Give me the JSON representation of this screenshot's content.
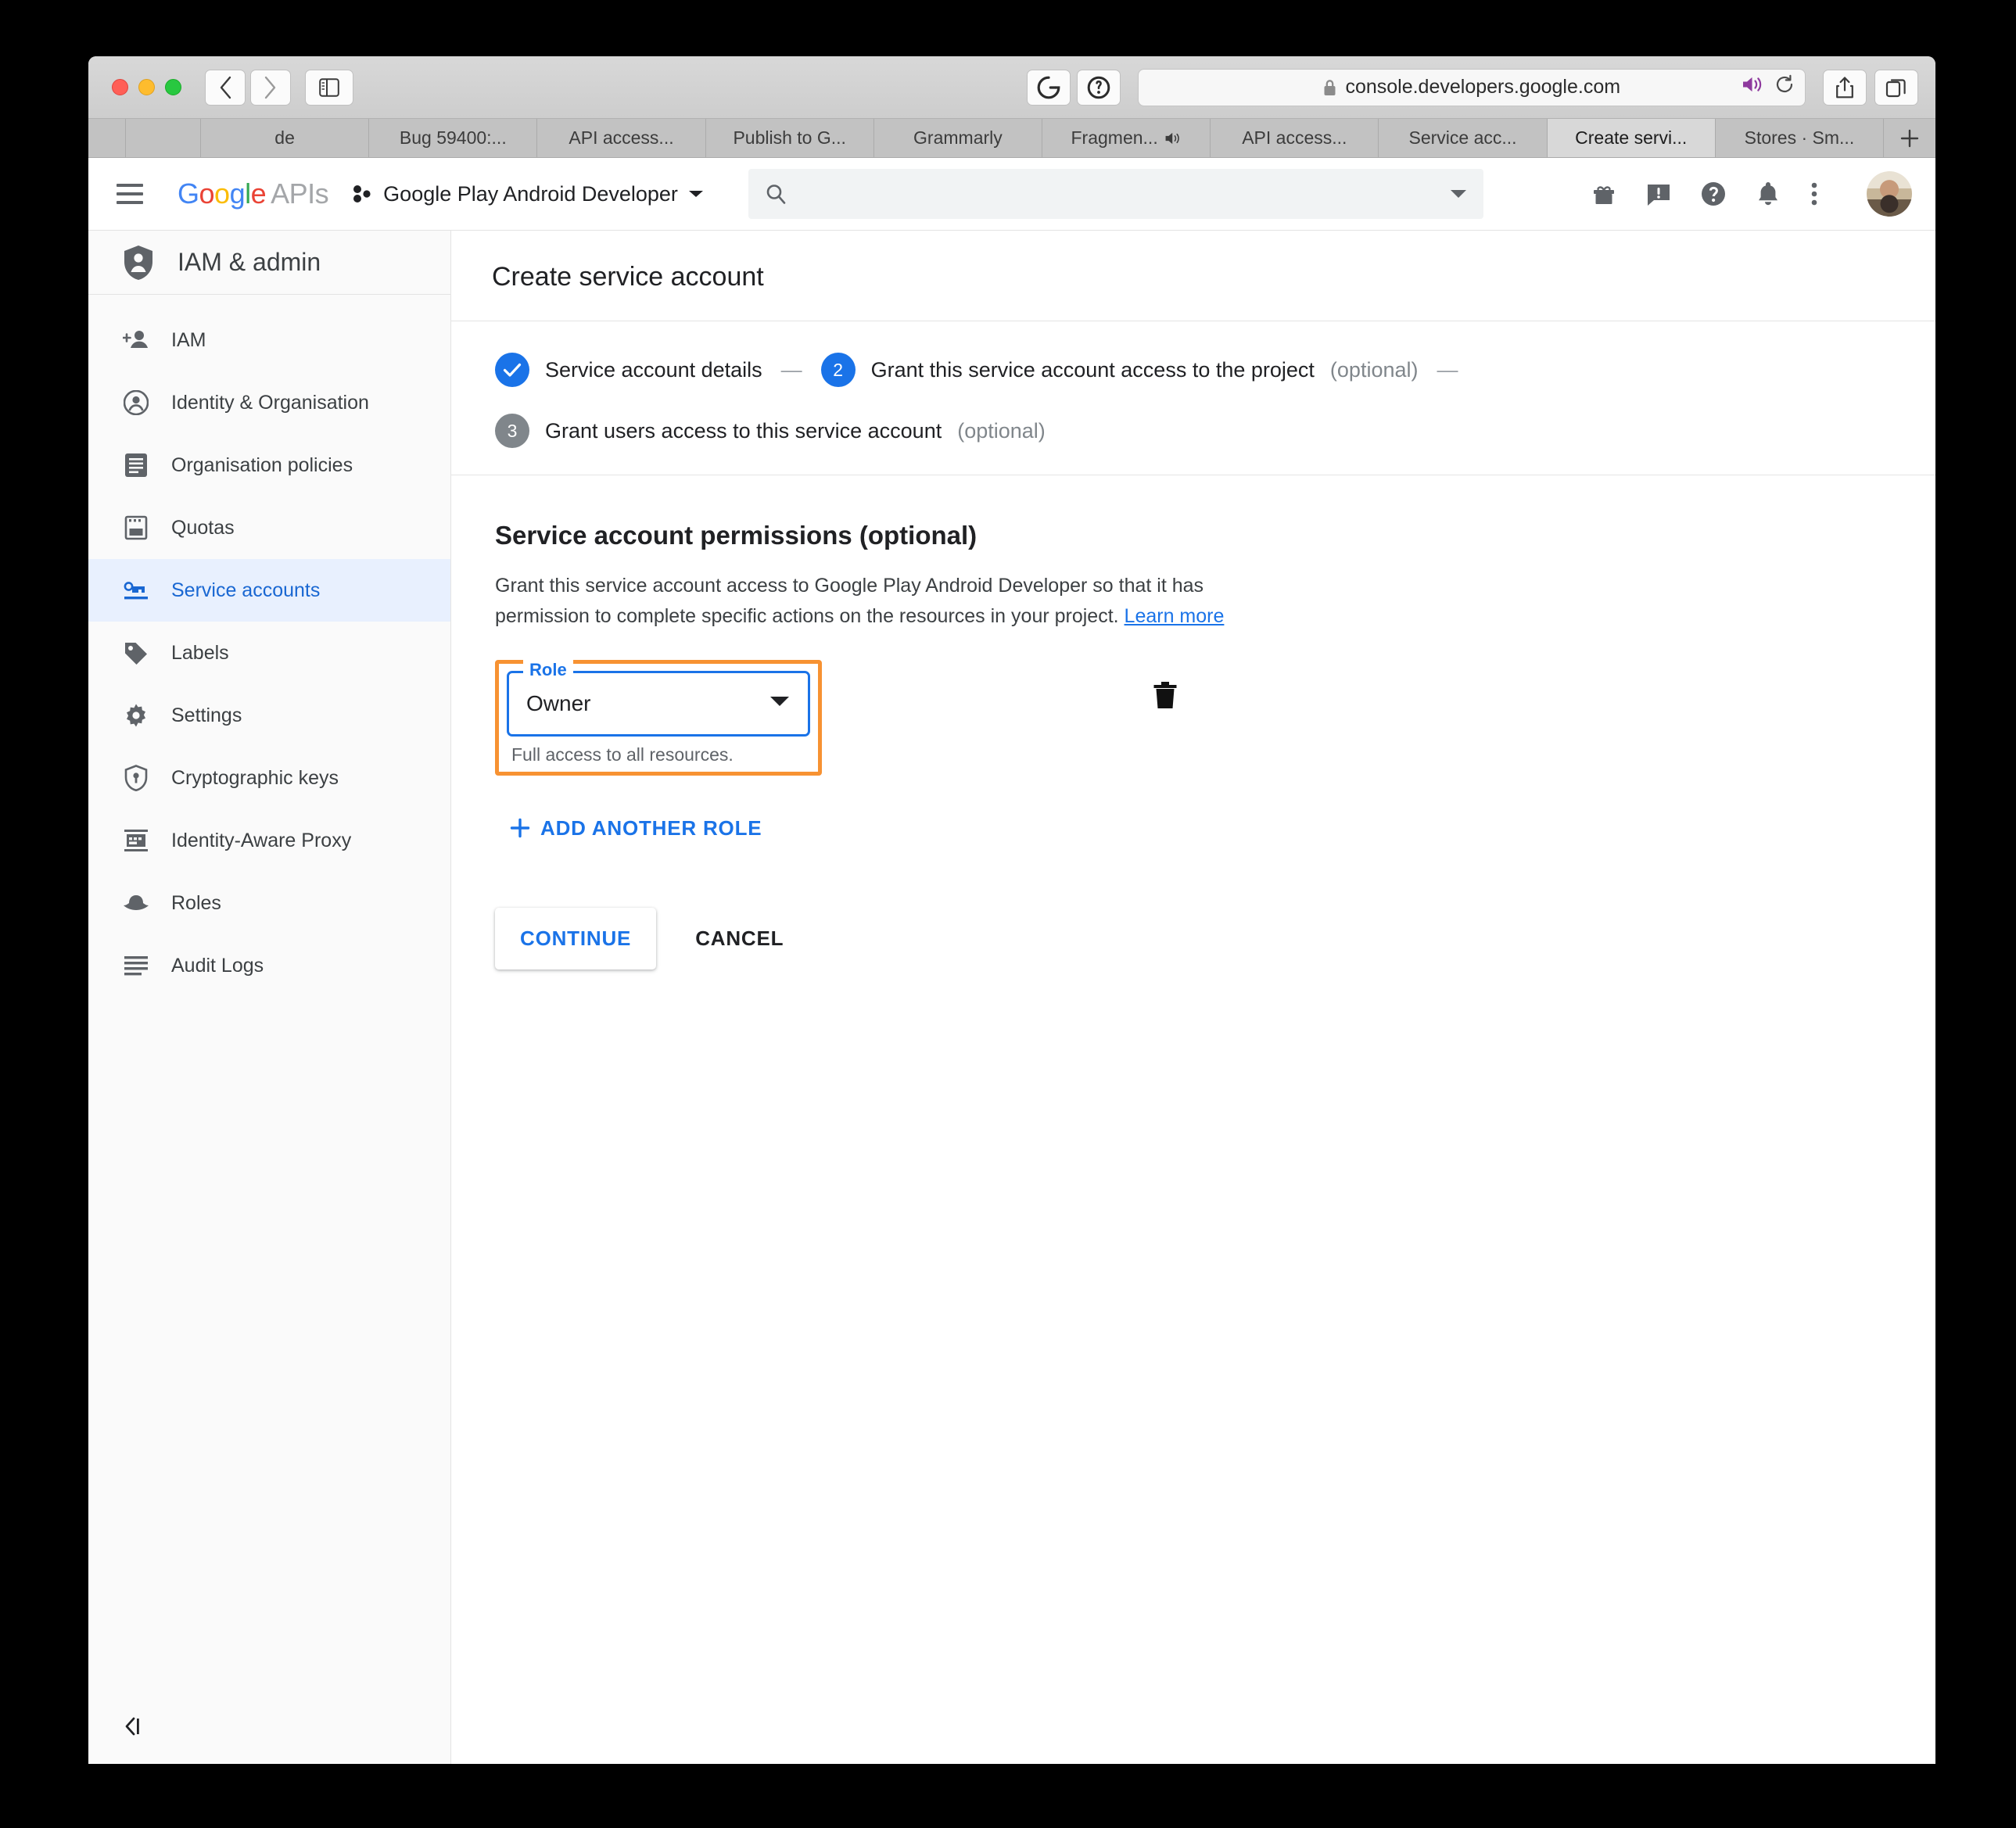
{
  "browser": {
    "url": "console.developers.google.com",
    "lock_icon": "lock-icon",
    "back_icon": "chevron-left-icon",
    "forward_icon": "chevron-right-icon",
    "sidebar_icon": "sidebar-toggle-icon",
    "grammarly_icon": "grammarly-extension-icon",
    "onepassword_icon": "1password-extension-icon",
    "audio_icon": "speaker-playing-icon",
    "reload_icon": "reload-icon",
    "share_icon": "share-icon",
    "tabs_overview_icon": "tab-overview-icon",
    "new_tab_icon": "plus-icon",
    "tabs": [
      {
        "label": "",
        "muted": false
      },
      {
        "label": "",
        "muted": false
      },
      {
        "label": "de",
        "muted": false
      },
      {
        "label": "Bug 59400:...",
        "muted": false
      },
      {
        "label": "API access...",
        "muted": false
      },
      {
        "label": "Publish to G...",
        "muted": false
      },
      {
        "label": "Grammarly",
        "muted": false
      },
      {
        "label": "Fragmen...",
        "muted": true
      },
      {
        "label": "API access...",
        "muted": false
      },
      {
        "label": "Service acc...",
        "muted": false
      },
      {
        "label": "Create servi...",
        "muted": false,
        "active": true
      },
      {
        "label": "Stores · Sm...",
        "muted": false
      }
    ]
  },
  "header": {
    "menu_icon": "hamburger-menu-icon",
    "logo_google": "Google",
    "logo_apis": "APIs",
    "project_name": "Google Play Android Developer",
    "project_caret_icon": "chevron-down-icon",
    "search": {
      "value": "",
      "placeholder": "",
      "icon": "search-icon",
      "caret_icon": "chevron-down-icon"
    },
    "icons": [
      {
        "name": "gift-icon"
      },
      {
        "name": "feedback-icon"
      },
      {
        "name": "help-icon"
      },
      {
        "name": "notifications-bell-icon"
      },
      {
        "name": "more-vert-icon"
      }
    ],
    "avatar": "user-avatar"
  },
  "sidebar": {
    "title": "IAM & admin",
    "title_icon": "shield-person-icon",
    "collapse_icon": "collapse-panel-icon",
    "items": [
      {
        "label": "IAM",
        "icon": "person-add-icon",
        "active": false
      },
      {
        "label": "Identity & Organisation",
        "icon": "account-circle-icon",
        "active": false
      },
      {
        "label": "Organisation policies",
        "icon": "list-document-icon",
        "active": false
      },
      {
        "label": "Quotas",
        "icon": "quota-icon",
        "active": false
      },
      {
        "label": "Service accounts",
        "icon": "key-card-icon",
        "active": true
      },
      {
        "label": "Labels",
        "icon": "label-tag-icon",
        "active": false
      },
      {
        "label": "Settings",
        "icon": "gear-icon",
        "active": false
      },
      {
        "label": "Cryptographic keys",
        "icon": "shield-key-icon",
        "active": false
      },
      {
        "label": "Identity-Aware Proxy",
        "icon": "iap-icon",
        "active": false
      },
      {
        "label": "Roles",
        "icon": "hat-icon",
        "active": false
      },
      {
        "label": "Audit Logs",
        "icon": "audit-list-icon",
        "active": false
      }
    ]
  },
  "main": {
    "page_title": "Create service account",
    "stepper": {
      "row1": [
        {
          "num": "1",
          "state": "done",
          "check_icon": "check-icon",
          "label": "Service account details",
          "optional": ""
        },
        {
          "num": "2",
          "state": "current",
          "label": "Grant this service account access to the project",
          "optional": "(optional)"
        }
      ],
      "row2": [
        {
          "num": "3",
          "state": "future",
          "label": "Grant users access to this service account",
          "optional": "(optional)"
        }
      ],
      "dash": "—"
    },
    "section_title": "Service account permissions (optional)",
    "section_desc_1": "Grant this service account access to Google Play Android Developer so that it has",
    "section_desc_2": "permission to complete specific actions on the resources in your project. ",
    "learn_more": "Learn more",
    "role": {
      "legend": "Role",
      "value": "Owner",
      "hint": "Full access to all resources.",
      "caret_icon": "dropdown-caret-icon",
      "delete_icon": "trash-icon",
      "highlight_color": "#f79232",
      "focus_color": "#1a73e8"
    },
    "add_role_label": "ADD ANOTHER ROLE",
    "add_role_icon": "plus-icon",
    "continue_label": "CONTINUE",
    "cancel_label": "CANCEL"
  },
  "colors": {
    "google_blue": "#1a73e8",
    "link_blue": "#1967d2",
    "highlight_orange": "#f79232",
    "grey_step": "#80868b"
  }
}
